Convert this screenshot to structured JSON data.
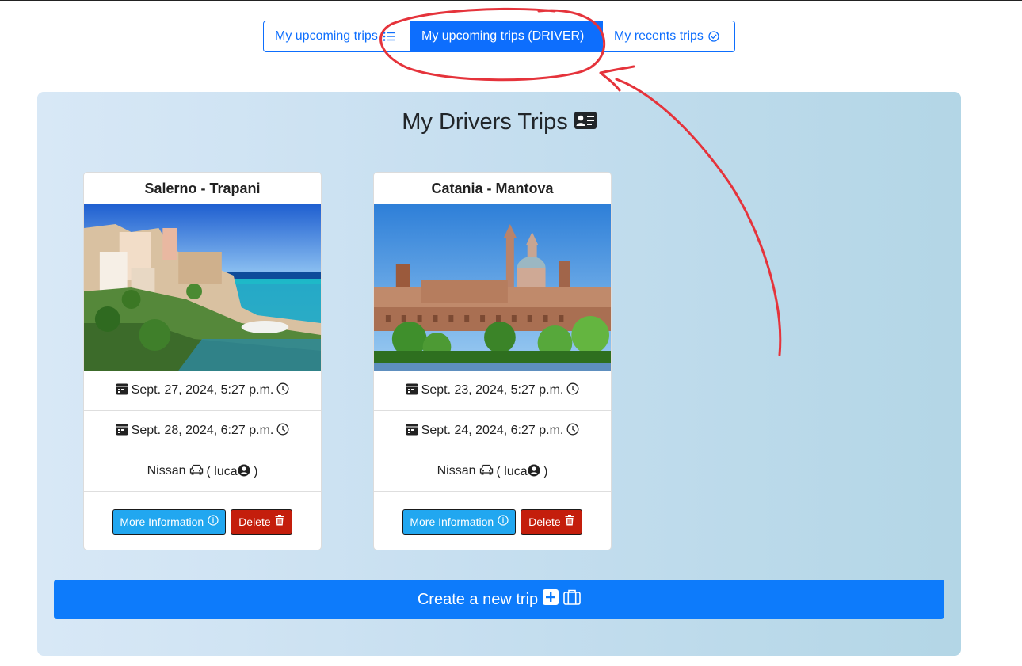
{
  "tabs": [
    {
      "label": "My upcoming trips",
      "icon": "list-icon",
      "active": false
    },
    {
      "label": "My upcoming trips (DRIVER)",
      "icon": "",
      "active": true
    },
    {
      "label": "My recents trips",
      "icon": "check-circle-icon",
      "active": false
    }
  ],
  "panel": {
    "title": "My Drivers Trips",
    "title_icon": "person-vcard-icon"
  },
  "cards": [
    {
      "title": "Salerno - Trapani",
      "image": "coastal-town-photo",
      "departure": "Sept. 27, 2024, 5:27 p.m.",
      "arrival": "Sept. 28, 2024, 6:27 p.m.",
      "car": "Nissan",
      "driver_prefix": "( luca",
      "driver_suffix": " )",
      "more_info_label": "More Information",
      "delete_label": "Delete"
    },
    {
      "title": "Catania - Mantova",
      "image": "city-cathedral-photo",
      "departure": "Sept. 23, 2024, 5:27 p.m.",
      "arrival": "Sept. 24, 2024, 6:27 p.m.",
      "car": "Nissan",
      "driver_prefix": "( luca",
      "driver_suffix": " )",
      "more_info_label": "More Information",
      "delete_label": "Delete"
    }
  ],
  "create_button": {
    "label": "Create a new trip"
  },
  "colors": {
    "primary": "#0d6efd",
    "info": "#21a7f0",
    "danger": "#c41e0c",
    "annotation": "#e5333b"
  }
}
